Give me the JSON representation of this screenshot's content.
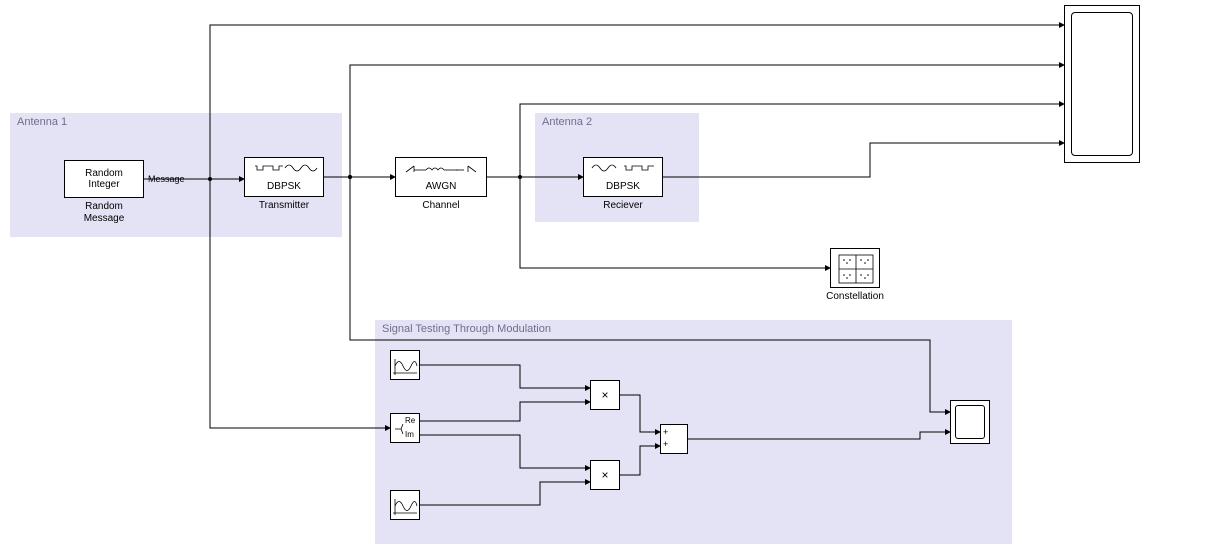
{
  "areas": {
    "antenna1": {
      "label": "Antenna 1"
    },
    "antenna2": {
      "label": "Antenna 2"
    },
    "sigtest": {
      "label": "Signal Testing Through Modulation"
    }
  },
  "blocks": {
    "randint": {
      "text1": "Random",
      "text2": "Integer",
      "label": "Random\nMessage",
      "port_out": "Message"
    },
    "transmitter": {
      "text": "DBPSK",
      "label": "Transmitter"
    },
    "channel": {
      "text": "AWGN",
      "label": "Channel"
    },
    "receiver": {
      "text": "DBPSK",
      "label": "Reciever"
    },
    "constellation": {
      "label": "Constellation"
    },
    "scope_main": {},
    "sinewave1": {},
    "sinewave2": {},
    "reim": {
      "re": "Re",
      "im": "Im"
    },
    "mult1": {
      "sym": "×"
    },
    "mult2": {
      "sym": "×"
    },
    "sum": {
      "p1": "+",
      "p2": "+"
    },
    "scope2": {}
  }
}
